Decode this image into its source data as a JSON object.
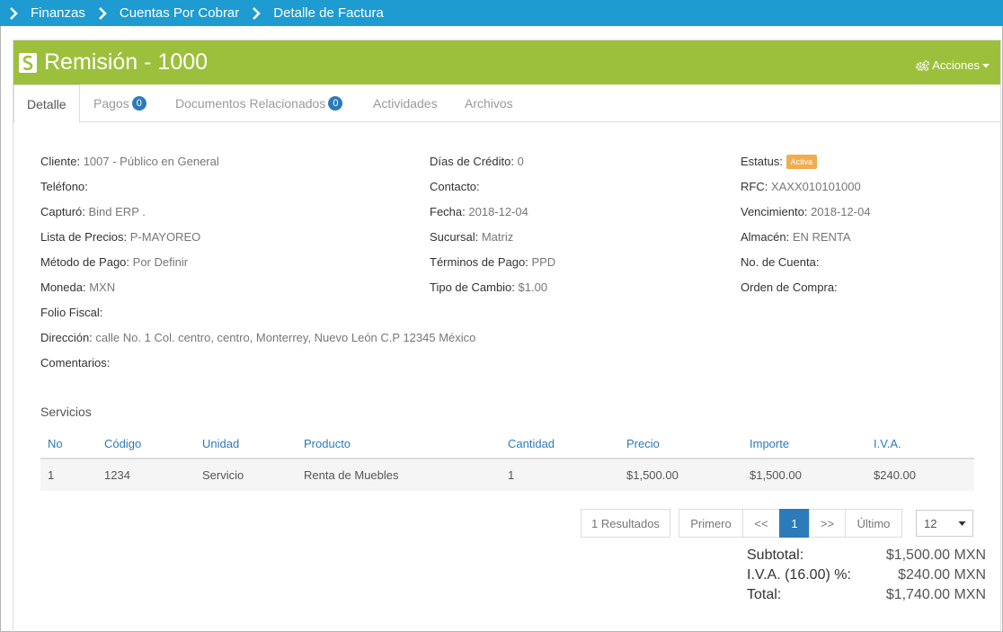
{
  "breadcrumb": [
    "Finanzas",
    "Cuentas Por Cobrar",
    "Detalle de Factura"
  ],
  "header": {
    "title": "Remisión - 1000",
    "actions_label": "Acciones",
    "color": "#9dc03c"
  },
  "tabs": [
    {
      "label": "Detalle",
      "badge": null
    },
    {
      "label": "Pagos",
      "badge": "0"
    },
    {
      "label": "Documentos Relacionados",
      "badge": "0"
    },
    {
      "label": "Actividades",
      "badge": null
    },
    {
      "label": "Archivos",
      "badge": null
    }
  ],
  "details": {
    "cliente": {
      "label": "Cliente:",
      "value": "1007 - Público en General"
    },
    "telefono": {
      "label": "Teléfono:",
      "value": ""
    },
    "capturo": {
      "label": "Capturó:",
      "value": "Bind ERP ."
    },
    "lista_precios": {
      "label": "Lista de Precios:",
      "value": "P-MAYOREO"
    },
    "metodo_pago": {
      "label": "Método de Pago:",
      "value": "Por Definir"
    },
    "moneda": {
      "label": "Moneda:",
      "value": "MXN"
    },
    "folio_fiscal": {
      "label": "Folio Fiscal:",
      "value": ""
    },
    "direccion": {
      "label": "Dirección:",
      "value": "calle No. 1 Col. centro, centro, Monterrey, Nuevo León C.P 12345 México"
    },
    "comentarios": {
      "label": "Comentarios:",
      "value": ""
    },
    "dias_credito": {
      "label": "Días de Crédito:",
      "value": "0"
    },
    "contacto": {
      "label": "Contacto:",
      "value": ""
    },
    "fecha": {
      "label": "Fecha:",
      "value": "2018-12-04"
    },
    "sucursal": {
      "label": "Sucursal:",
      "value": "Matriz"
    },
    "terminos_pago": {
      "label": "Términos de Pago:",
      "value": "PPD"
    },
    "tipo_cambio": {
      "label": "Tipo de Cambio:",
      "value": "$1.00"
    },
    "estatus": {
      "label": "Estatus:",
      "value": "Activa"
    },
    "rfc": {
      "label": "RFC:",
      "value": "XAXX010101000"
    },
    "vencimiento": {
      "label": "Vencimiento:",
      "value": "2018-12-04"
    },
    "almacen": {
      "label": "Almacén:",
      "value": "EN RENTA"
    },
    "no_cuenta": {
      "label": "No. de Cuenta:",
      "value": ""
    },
    "orden_compra": {
      "label": "Orden de Compra:",
      "value": ""
    }
  },
  "services": {
    "title": "Servicios",
    "columns": [
      "No",
      "Código",
      "Unidad",
      "Producto",
      "Cantidad",
      "Precio",
      "Importe",
      "I.V.A."
    ],
    "rows": [
      [
        "1",
        "1234",
        "Servicio",
        "Renta de Muebles",
        "1",
        "$1,500.00",
        "$1,500.00",
        "$240.00"
      ]
    ]
  },
  "pagination": {
    "results": "1 Resultados",
    "first": "Primero",
    "prev": "<<",
    "current": "1",
    "next": ">>",
    "last": "Último",
    "page_size": "12"
  },
  "totals": {
    "subtotal_label": "Subtotal:",
    "subtotal": "$1,500.00 MXN",
    "iva_label": "I.V.A. (16.00) %:",
    "iva": "$240.00 MXN",
    "total_label": "Total:",
    "total": "$1,740.00 MXN"
  }
}
